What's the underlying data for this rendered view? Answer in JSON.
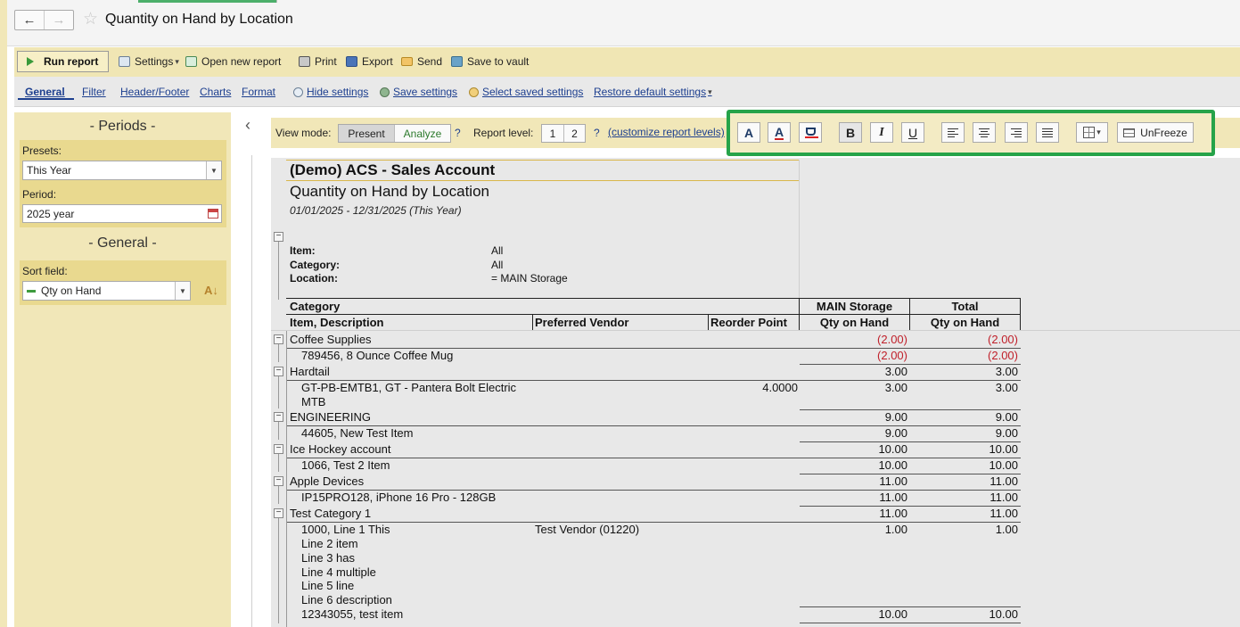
{
  "header": {
    "back_label": "←",
    "forward_label": "→",
    "page_title": "Quantity on Hand by Location"
  },
  "toolbar": {
    "run_report": "Run report",
    "settings": "Settings",
    "open_new_report": "Open new report",
    "print": "Print",
    "export": "Export",
    "send": "Send",
    "save_to_vault": "Save to vault"
  },
  "subnav": {
    "general": "General",
    "filter": "Filter",
    "header_footer": "Header/Footer",
    "charts": "Charts",
    "format": "Format",
    "hide_settings": "Hide settings",
    "save_settings": "Save settings",
    "select_saved_settings": "Select saved settings",
    "restore_default_settings": "Restore default settings"
  },
  "left_panel": {
    "periods_title": "- Periods -",
    "presets_label": "Presets:",
    "presets_value": "This Year",
    "period_label": "Period:",
    "period_value": "2025 year",
    "general_title": "- General -",
    "sort_field_label": "Sort field:",
    "sort_field_value": "Qty on Hand"
  },
  "viewbar": {
    "view_mode_label": "View mode:",
    "present": "Present",
    "analyze": "Analyze",
    "help": "?",
    "report_level_label": "Report level:",
    "level_1": "1",
    "level_2": "2",
    "customize_link": "(customize report levels)"
  },
  "format_toolbar": {
    "font_label": "A",
    "font_color_label": "A",
    "bold_label": "B",
    "italic_label": "I",
    "underline_label": "U",
    "unfreeze_label": "UnFreeze",
    "highlight_color": "#26a349"
  },
  "report": {
    "company": "(Demo) ACS - Sales Account",
    "title": "Quantity on Hand by Location",
    "date_range": "01/01/2025 - 12/31/2025 (This Year)",
    "filters": [
      {
        "label": "Item:",
        "value": "All"
      },
      {
        "label": "Category:",
        "value": "All"
      },
      {
        "label": "Location:",
        "value": "= MAIN Storage"
      }
    ],
    "columns": {
      "category": "Category",
      "item_description": "Item, Description",
      "preferred_vendor": "Preferred Vendor",
      "reorder_point": "Reorder Point",
      "main_storage": "MAIN Storage",
      "total": "Total",
      "qty_on_hand_1": "Qty on Hand",
      "qty_on_hand_2": "Qty on Hand"
    },
    "rows": [
      {
        "type": "category",
        "name": "Coffee Supplies",
        "main": "(2.00)",
        "total": "(2.00)"
      },
      {
        "type": "item",
        "name": "789456, 8 Ounce Coffee Mug",
        "main": "(2.00)",
        "total": "(2.00)"
      },
      {
        "type": "category",
        "name": "Hardtail",
        "main": "3.00",
        "total": "3.00"
      },
      {
        "type": "item",
        "name": "GT-PB-EMTB1, GT - Pantera Bolt Electric",
        "name2": "MTB",
        "reorder": "4.0000",
        "main": "3.00",
        "total": "3.00"
      },
      {
        "type": "category",
        "name": "ENGINEERING",
        "main": "9.00",
        "total": "9.00"
      },
      {
        "type": "item",
        "name": "44605, New Test Item",
        "main": "9.00",
        "total": "9.00"
      },
      {
        "type": "category",
        "name": "Ice Hockey account",
        "main": "10.00",
        "total": "10.00"
      },
      {
        "type": "item",
        "name": "1066, Test 2 Item",
        "main": "10.00",
        "total": "10.00"
      },
      {
        "type": "category",
        "name": "Apple Devices",
        "main": "11.00",
        "total": "11.00"
      },
      {
        "type": "item",
        "name": "IP15PRO128, iPhone 16 Pro - 128GB",
        "main": "11.00",
        "total": "11.00"
      },
      {
        "type": "category",
        "name": "Test Category 1",
        "main": "11.00",
        "total": "11.00"
      },
      {
        "type": "item",
        "name": "1000, Line 1 This",
        "vendor": "Test Vendor (01220)",
        "main": "1.00",
        "total": "1.00",
        "extra_lines": [
          "Line 2 item",
          "Line 3 has",
          "Line 4 multiple",
          "Line 5 line",
          "Line 6 description"
        ]
      },
      {
        "type": "item",
        "name": "12343055, test item",
        "main": "10.00",
        "total": "10.00"
      }
    ]
  }
}
